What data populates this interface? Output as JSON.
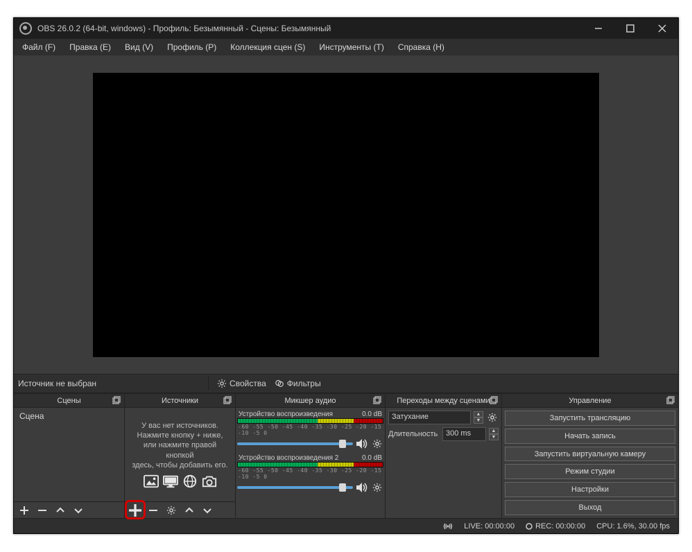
{
  "window": {
    "title": "OBS 26.0.2 (64-bit, windows) - Профиль: Безымянный - Сцены: Безымянный"
  },
  "menu": {
    "file": "Файл (F)",
    "edit": "Правка (E)",
    "view": "Вид (V)",
    "profile": "Профиль (P)",
    "scene_collection": "Коллекция сцен (S)",
    "tools": "Инструменты (T)",
    "help": "Справка (H)"
  },
  "toolbar": {
    "no_source": "Источник не выбран",
    "properties": "Свойства",
    "filters": "Фильтры"
  },
  "docks": {
    "scenes": {
      "title": "Сцены",
      "item": "Сцена"
    },
    "sources": {
      "title": "Источники",
      "empty_l1": "У вас нет источников.",
      "empty_l2": "Нажмите кнопку + ниже,",
      "empty_l3": "или нажмите правой кнопкой",
      "empty_l4": "здесь, чтобы добавить его."
    },
    "mixer": {
      "title": "Микшер аудио",
      "ch1": "Устройство воспроизведения",
      "ch2": "Устройство воспроизведения 2",
      "db": "0.0 dB",
      "scale": "-60 -55 -50 -45 -40 -35 -30 -25 -20 -15 -10 -5  0"
    },
    "transitions": {
      "title": "Переходы между сценами",
      "fade": "Затухание",
      "duration_label": "Длительность",
      "duration_value": "300 ms"
    },
    "controls": {
      "title": "Управление",
      "start_stream": "Запустить трансляцию",
      "start_record": "Начать запись",
      "start_vcam": "Запустить виртуальную камеру",
      "studio_mode": "Режим студии",
      "settings": "Настройки",
      "exit": "Выход"
    }
  },
  "status": {
    "live": "LIVE: 00:00:00",
    "rec": "REC: 00:00:00",
    "cpu": "CPU: 1.6%, 30.00 fps"
  }
}
